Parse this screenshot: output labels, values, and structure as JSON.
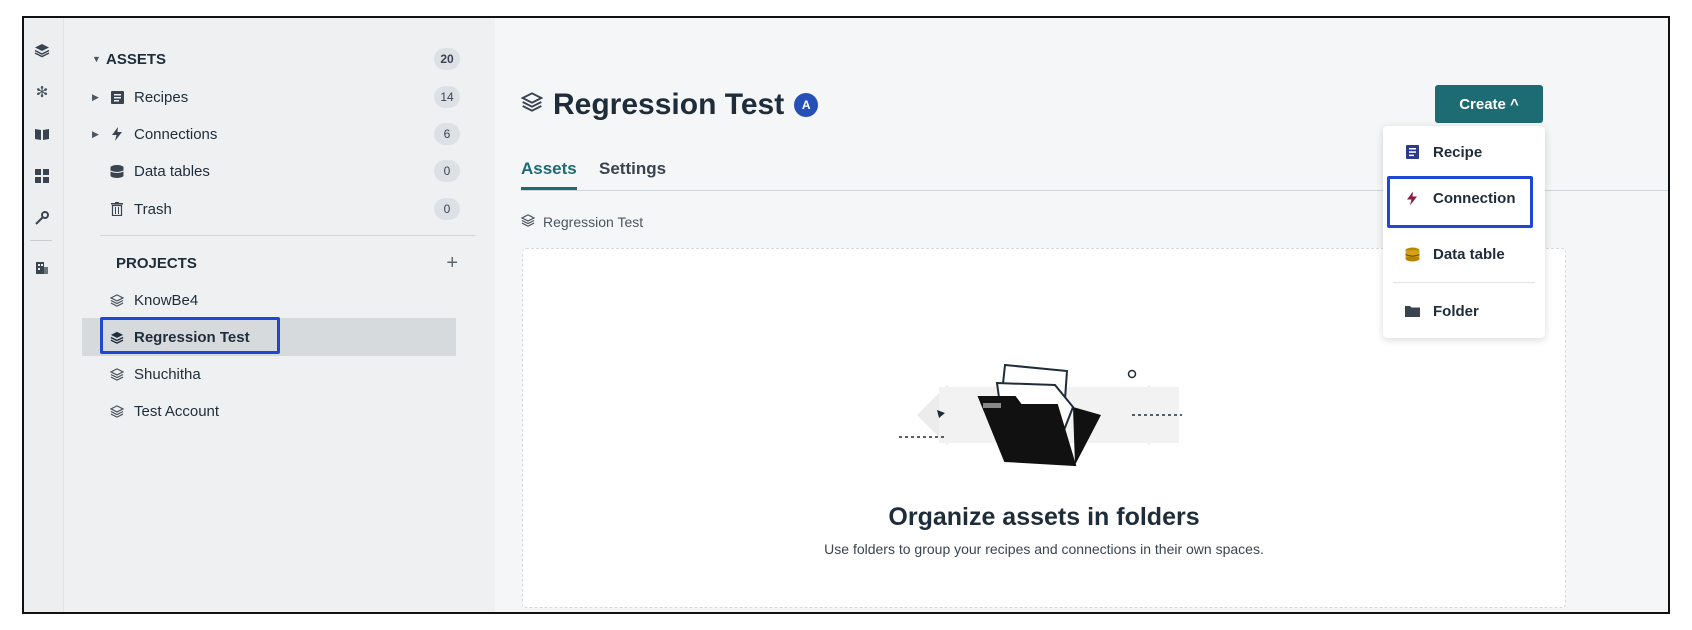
{
  "colors": {
    "accent": "#1d6b73",
    "highlight": "#1e47d4",
    "badge": "#2450b8"
  },
  "rail": {
    "icons": [
      "projects-icon",
      "sparkle-icon",
      "book-icon",
      "dashboard-icon",
      "wrench-icon",
      "building-icon"
    ]
  },
  "sidebar": {
    "assets": {
      "label": "ASSETS",
      "count": "20"
    },
    "items": [
      {
        "label": "Recipes",
        "count": "14",
        "icon": "recipe-icon"
      },
      {
        "label": "Connections",
        "count": "6",
        "icon": "lightning-icon"
      },
      {
        "label": "Data tables",
        "count": "0",
        "icon": "database-icon"
      },
      {
        "label": "Trash",
        "count": "0",
        "icon": "trash-icon"
      }
    ],
    "projects_label": "PROJECTS",
    "projects": [
      "KnowBe4",
      "Regression Test",
      "Shuchitha",
      "Test Account"
    ]
  },
  "main": {
    "title": "Regression Test",
    "badge": "A",
    "tabs": [
      "Assets",
      "Settings"
    ],
    "breadcrumb": "Regression Test",
    "empty_title": "Organize assets in folders",
    "empty_subtitle": "Use folders to group your recipes and connections in their own spaces."
  },
  "create": {
    "label": "Create ^",
    "menu": [
      "Recipe",
      "Connection",
      "Data table",
      "Folder"
    ]
  }
}
